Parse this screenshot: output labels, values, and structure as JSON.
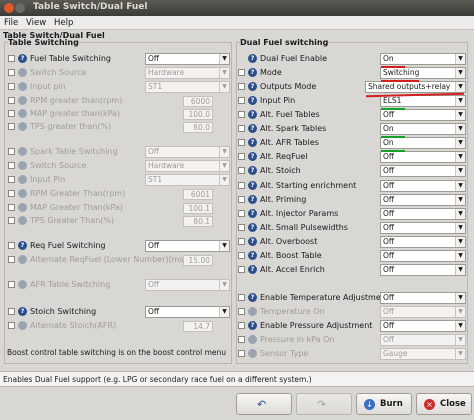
{
  "window": {
    "title": "Table Switch/Dual Fuel"
  },
  "menu": {
    "file": "File",
    "view": "View",
    "help": "Help"
  },
  "panel_title": "Table Switch/Dual Fuel",
  "left": {
    "title": "Table Switching",
    "rows": [
      {
        "label": "Fuel Table Switching",
        "value": "Off",
        "kind": "combo",
        "enabled": true,
        "check": true
      },
      {
        "label": "Switch Source",
        "value": "Hardware",
        "kind": "combo",
        "enabled": false,
        "check": true
      },
      {
        "label": "Input pin",
        "value": "ST1",
        "kind": "combo",
        "enabled": false,
        "check": true
      },
      {
        "label": "RPM greater than(rpm)",
        "value": "6000",
        "kind": "field",
        "enabled": false,
        "check": true
      },
      {
        "label": "MAP greater than(kPa)",
        "value": "100.0",
        "kind": "field",
        "enabled": false,
        "check": true
      },
      {
        "label": "TPS greater than(%)",
        "value": "80.0",
        "kind": "field",
        "enabled": false,
        "check": true
      },
      {
        "label": "Spark Table Switching",
        "value": "Off",
        "kind": "combo",
        "enabled": false,
        "check": true
      },
      {
        "label": "Switch Source",
        "value": "Hardware",
        "kind": "combo",
        "enabled": false,
        "check": true
      },
      {
        "label": "Input Pin",
        "value": "ST1",
        "kind": "combo",
        "enabled": false,
        "check": true
      },
      {
        "label": "RPM Greater Than(rpm)",
        "value": "6001",
        "kind": "field",
        "enabled": false,
        "check": true
      },
      {
        "label": "MAP Greater Than(kPa)",
        "value": "100.1",
        "kind": "field",
        "enabled": false,
        "check": true
      },
      {
        "label": "TPS Greater Than(%)",
        "value": "80.1",
        "kind": "field",
        "enabled": false,
        "check": true
      },
      {
        "label": "Req Fuel Switching",
        "value": "Off",
        "kind": "combo",
        "enabled": true,
        "check": true
      },
      {
        "label": "Alternate ReqFuel (Lower Number)(ms)",
        "value": "15.00",
        "kind": "field",
        "enabled": false,
        "check": true
      },
      {
        "label": "AFR Table Switching",
        "value": "Off",
        "kind": "combo",
        "enabled": false,
        "check": true
      },
      {
        "label": "Stoich Switching",
        "value": "Off",
        "kind": "combo",
        "enabled": true,
        "check": true
      },
      {
        "label": "Alternate Stoich(AFR)",
        "value": "14.7",
        "kind": "field",
        "enabled": false,
        "check": true
      }
    ],
    "note": "Boost control table switching is on the boost control menu"
  },
  "right": {
    "title": "Dual Fuel switching",
    "rows": [
      {
        "label": "Dual Fuel Enable",
        "value": "On",
        "kind": "combo",
        "enabled": true,
        "check": false
      },
      {
        "label": "Mode",
        "value": "Switching",
        "kind": "combo",
        "enabled": true,
        "check": true
      },
      {
        "label": "Outputs Mode",
        "value": "Shared outputs+relay",
        "kind": "combo",
        "enabled": true,
        "check": true
      },
      {
        "label": "Input Pin",
        "value": "ELS1",
        "kind": "combo",
        "enabled": true,
        "check": true
      },
      {
        "label": "Alt. Fuel Tables",
        "value": "Off",
        "kind": "combo",
        "enabled": true,
        "check": true
      },
      {
        "label": "Alt. Spark Tables",
        "value": "On",
        "kind": "combo",
        "enabled": true,
        "check": true
      },
      {
        "label": "Alt. AFR Tables",
        "value": "On",
        "kind": "combo",
        "enabled": true,
        "check": true
      },
      {
        "label": "Alt. ReqFuel",
        "value": "Off",
        "kind": "combo",
        "enabled": true,
        "check": true
      },
      {
        "label": "Alt. Stoich",
        "value": "Off",
        "kind": "combo",
        "enabled": true,
        "check": true
      },
      {
        "label": "Alt. Starting enrichment",
        "value": "Off",
        "kind": "combo",
        "enabled": true,
        "check": true
      },
      {
        "label": "Alt. Priming",
        "value": "Off",
        "kind": "combo",
        "enabled": true,
        "check": true
      },
      {
        "label": "Alt. Injector Params",
        "value": "Off",
        "kind": "combo",
        "enabled": true,
        "check": true
      },
      {
        "label": "Alt. Small Pulsewidths",
        "value": "Off",
        "kind": "combo",
        "enabled": true,
        "check": true
      },
      {
        "label": "Alt. Overboost",
        "value": "Off",
        "kind": "combo",
        "enabled": true,
        "check": true
      },
      {
        "label": "Alt. Boost Table",
        "value": "Off",
        "kind": "combo",
        "enabled": true,
        "check": true
      },
      {
        "label": "Alt. Accel Enrich",
        "value": "Off",
        "kind": "combo",
        "enabled": true,
        "check": true
      },
      {
        "label": "Enable Temperature Adjustment",
        "value": "Off",
        "kind": "combo",
        "enabled": true,
        "check": true
      },
      {
        "label": "Temperature On",
        "value": "Off",
        "kind": "combo",
        "enabled": false,
        "check": true
      },
      {
        "label": "Enable Pressure Adjustment",
        "value": "Off",
        "kind": "combo",
        "enabled": true,
        "check": true
      },
      {
        "label": "Pressure in kPa On",
        "value": "Off",
        "kind": "combo",
        "enabled": false,
        "check": true
      },
      {
        "label": "Sensor Type",
        "value": "Gauge",
        "kind": "combo",
        "enabled": false,
        "check": true
      }
    ]
  },
  "status": "Enables Dual Fuel support (e.g. LPG or secondary race fuel on a different system.)",
  "buttons": {
    "burn": "Burn",
    "close": "Close"
  },
  "colors": {
    "accent_underline_red": "#d12020",
    "accent_underline_green": "#18a028",
    "help_icon": "#2b4f8c"
  }
}
